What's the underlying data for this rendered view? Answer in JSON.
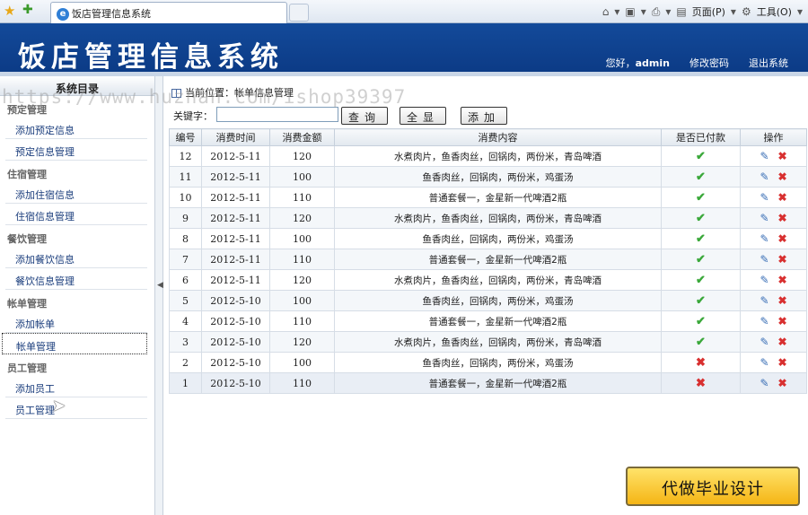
{
  "browser": {
    "tab_title": "饭店管理信息系统",
    "page_menu": "页面(P)",
    "tools_menu": "工具(O)"
  },
  "header": {
    "title": "饭店管理信息系统",
    "greeting": "您好，",
    "user": "admin",
    "change_password": "修改密码",
    "logout": "退出系统"
  },
  "sidebar": {
    "title": "系统目录",
    "sections": [
      {
        "label": "预定管理",
        "items": [
          "添加预定信息",
          "预定信息管理"
        ]
      },
      {
        "label": "住宿管理",
        "items": [
          "添加住宿信息",
          "住宿信息管理"
        ]
      },
      {
        "label": "餐饮管理",
        "items": [
          "添加餐饮信息",
          "餐饮信息管理"
        ]
      },
      {
        "label": "帐单管理",
        "items": [
          "添加帐单",
          "帐单管理"
        ]
      },
      {
        "label": "员工管理",
        "items": [
          "添加员工",
          "员工管理"
        ]
      }
    ]
  },
  "main": {
    "breadcrumb": "当前位置：帐单信息管理",
    "keyword_label": "关键字：",
    "keyword_value": "",
    "btn_query": "查询",
    "btn_all": "全显",
    "btn_add": "添加",
    "columns": [
      "编号",
      "消费时间",
      "消费金额",
      "消费内容",
      "是否已付款",
      "操作"
    ],
    "rows": [
      {
        "id": "12",
        "date": "2012-5-11",
        "amount": "120",
        "content": "水煮肉片，鱼香肉丝，回锅肉，两份米，青岛啤酒",
        "paid": true
      },
      {
        "id": "11",
        "date": "2012-5-11",
        "amount": "100",
        "content": "鱼香肉丝，回锅肉，两份米，鸡蛋汤",
        "paid": true
      },
      {
        "id": "10",
        "date": "2012-5-11",
        "amount": "110",
        "content": "普通套餐一，金星新一代啤酒2瓶",
        "paid": true
      },
      {
        "id": "9",
        "date": "2012-5-11",
        "amount": "120",
        "content": "水煮肉片，鱼香肉丝，回锅肉，两份米，青岛啤酒",
        "paid": true
      },
      {
        "id": "8",
        "date": "2012-5-11",
        "amount": "100",
        "content": "鱼香肉丝，回锅肉，两份米，鸡蛋汤",
        "paid": true
      },
      {
        "id": "7",
        "date": "2012-5-11",
        "amount": "110",
        "content": "普通套餐一，金星新一代啤酒2瓶",
        "paid": true
      },
      {
        "id": "6",
        "date": "2012-5-11",
        "amount": "120",
        "content": "水煮肉片，鱼香肉丝，回锅肉，两份米，青岛啤酒",
        "paid": true
      },
      {
        "id": "5",
        "date": "2012-5-10",
        "amount": "100",
        "content": "鱼香肉丝，回锅肉，两份米，鸡蛋汤",
        "paid": true
      },
      {
        "id": "4",
        "date": "2012-5-10",
        "amount": "110",
        "content": "普通套餐一，金星新一代啤酒2瓶",
        "paid": true
      },
      {
        "id": "3",
        "date": "2012-5-10",
        "amount": "120",
        "content": "水煮肉片，鱼香肉丝，回锅肉，两份米，青岛啤酒",
        "paid": true
      },
      {
        "id": "2",
        "date": "2012-5-10",
        "amount": "100",
        "content": "鱼香肉丝，回锅肉，两份米，鸡蛋汤",
        "paid": false
      },
      {
        "id": "1",
        "date": "2012-5-10",
        "amount": "110",
        "content": "普通套餐一，金星新一代啤酒2瓶",
        "paid": false
      }
    ]
  },
  "watermark": "https://www.huzhan.com/ishop39397",
  "promo": "代做毕业设计",
  "colors": {
    "header_blue": "#0c3b86",
    "paid_green": "#3aa83a",
    "unpaid_red": "#d83030"
  },
  "icons": [
    "favorites-star-icon",
    "add-favorite-icon",
    "ie-icon",
    "home-icon",
    "feeds-icon",
    "print-icon",
    "page-icon",
    "gear-icon",
    "check-icon",
    "cross-icon",
    "edit-pencil-icon",
    "delete-icon",
    "collapse-arrow-icon",
    "mouse-cursor-icon"
  ]
}
